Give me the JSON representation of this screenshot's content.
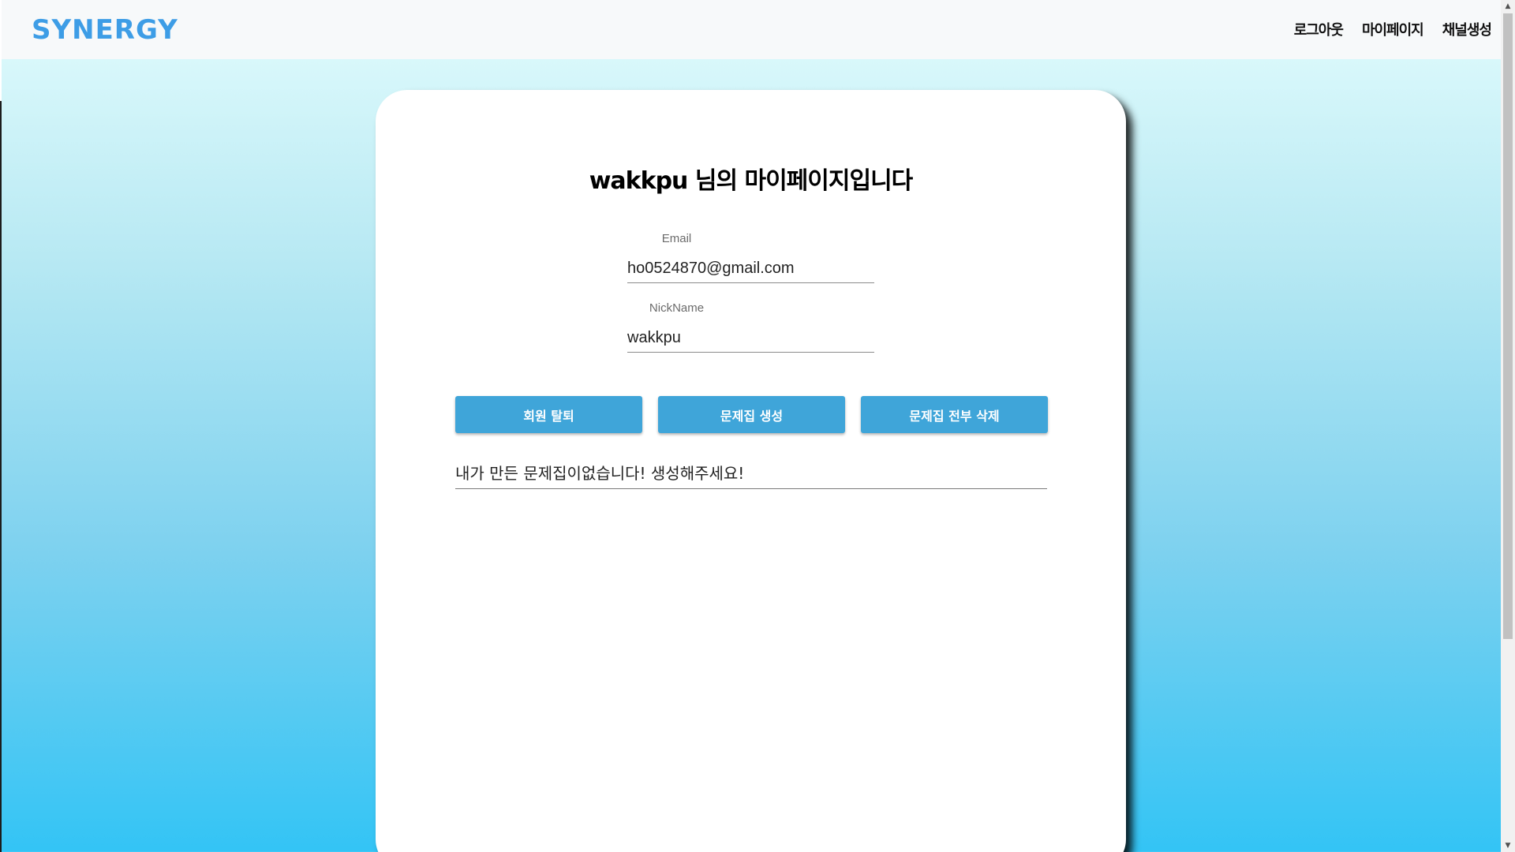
{
  "header": {
    "logo": "SYNERGY",
    "nav": [
      {
        "label": "로그아웃"
      },
      {
        "label": "마이페이지"
      },
      {
        "label": "채널생성"
      }
    ]
  },
  "main": {
    "title": "wakkpu 님의 마이페이지입니다",
    "email": {
      "label": "Email",
      "value": "ho0524870@gmail.com"
    },
    "nickname": {
      "label": "NickName",
      "value": "wakkpu"
    },
    "buttons": {
      "withdraw": "회원 탈퇴",
      "create_set": "문제집 생성",
      "delete_all": "문제집 전부 삭제"
    },
    "empty_message": "내가 만든 문제집이없습니다! 생성해주세요!"
  },
  "colors": {
    "brand": "#3d9de6",
    "button": "#3fa5d9",
    "gradient_top": "#e2fcfd",
    "gradient_bottom": "#33c4f5"
  }
}
